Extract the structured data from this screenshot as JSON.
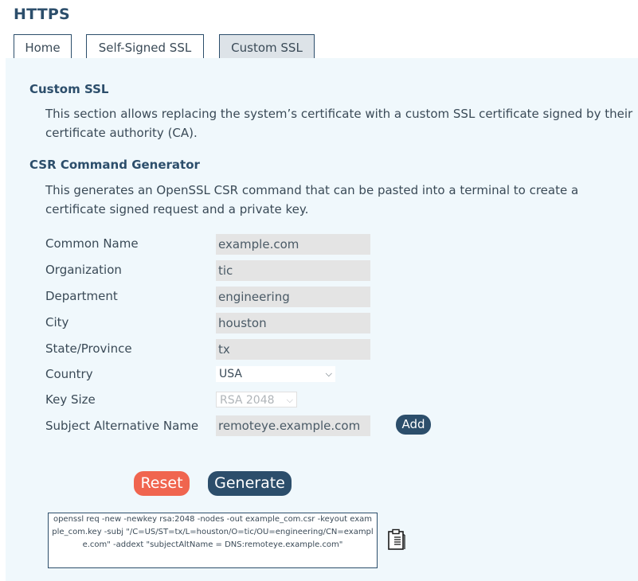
{
  "page": {
    "title": "HTTPS"
  },
  "tabs": [
    {
      "label": "Home"
    },
    {
      "label": "Self-Signed SSL"
    },
    {
      "label": "Custom SSL",
      "active": true
    }
  ],
  "custom_ssl": {
    "heading": "Custom SSL",
    "description": "This section allows replacing the system’s certificate with a custom SSL certificate signed by their certificate authority (CA)."
  },
  "csr": {
    "heading": "CSR Command Generator",
    "description": "This generates an OpenSSL CSR command that can be pasted into a terminal to create a certificate signed request and a private key.",
    "fields": {
      "common_name": {
        "label": "Common Name",
        "value": "example.com"
      },
      "organization": {
        "label": "Organization",
        "value": "tic"
      },
      "department": {
        "label": "Department",
        "value": "engineering"
      },
      "city": {
        "label": "City",
        "value": "houston"
      },
      "state": {
        "label": "State/Province",
        "value": "tx"
      },
      "country": {
        "label": "Country",
        "value": "USA"
      },
      "key_size": {
        "label": "Key Size",
        "value": "RSA 2048"
      },
      "san": {
        "label": "Subject Alternative Name",
        "value": "remoteye.example.com"
      }
    },
    "add_label": "Add",
    "reset_label": "Reset",
    "generate_label": "Generate",
    "output": "openssl req -new -newkey rsa:2048 -nodes -out example_com.csr -keyout example_com.key -subj \"/C=US/ST=tx/L=houston/O=tic/OU=engineering/CN=example.com\" -addext \"subjectAltName = DNS:remoteye.example.com\""
  },
  "icons": {
    "copy": "clipboard-icon"
  },
  "colors": {
    "primary": "#2c4e6b",
    "reset": "#f0654f",
    "panel": "#f0f8fc"
  }
}
